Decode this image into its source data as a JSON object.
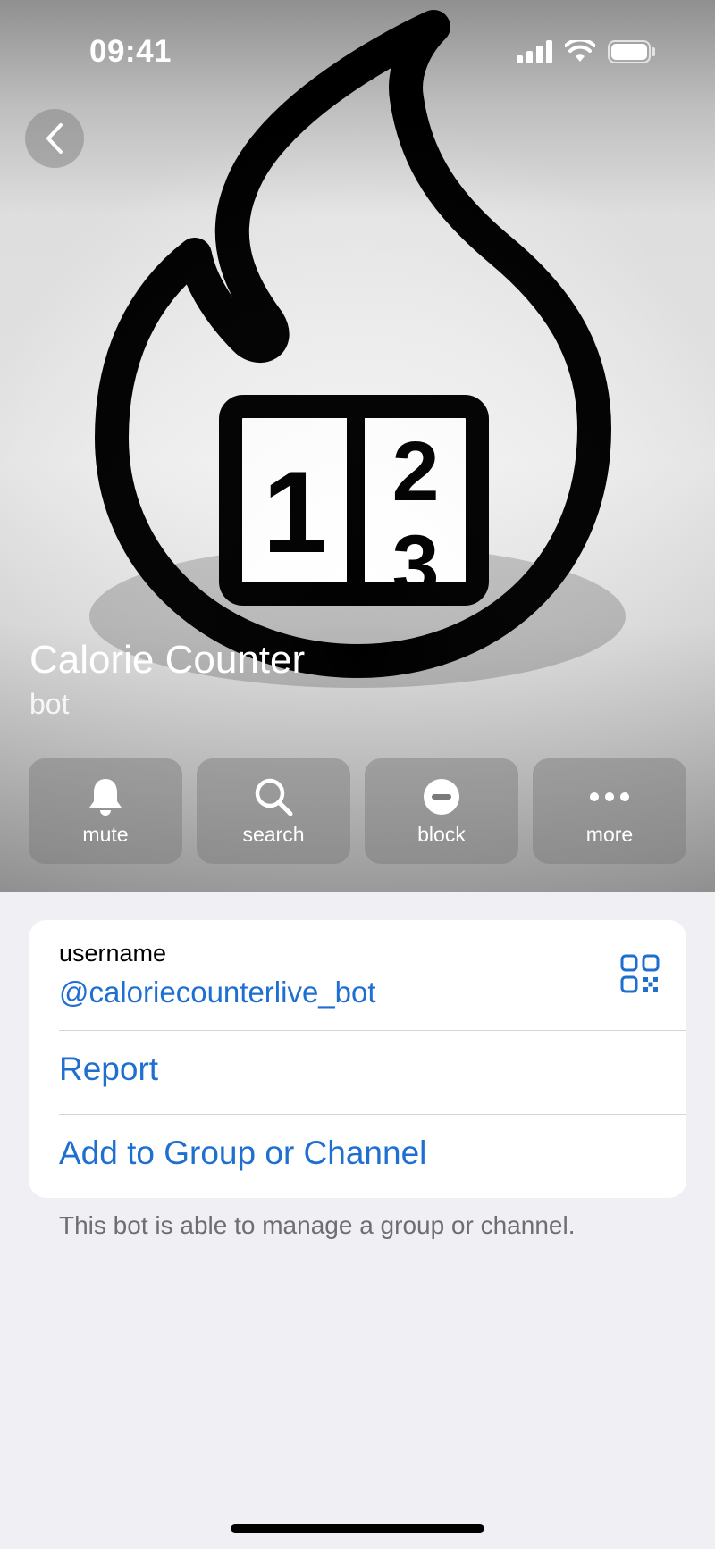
{
  "status_bar": {
    "time": "09:41"
  },
  "profile": {
    "name": "Calorie Counter",
    "subtitle": "bot"
  },
  "actions": [
    {
      "label": "mute",
      "icon": "bell-icon"
    },
    {
      "label": "search",
      "icon": "search-icon"
    },
    {
      "label": "block",
      "icon": "block-icon"
    },
    {
      "label": "more",
      "icon": "more-icon"
    }
  ],
  "info": {
    "username_label": "username",
    "username_value": "@caloriecounterlive_bot",
    "report_label": "Report",
    "add_to_group_label": "Add to Group or Channel",
    "footnote": "This bot is able to manage a group or channel."
  },
  "colors": {
    "accent": "#1f6fd1",
    "background": "#efeff4"
  }
}
